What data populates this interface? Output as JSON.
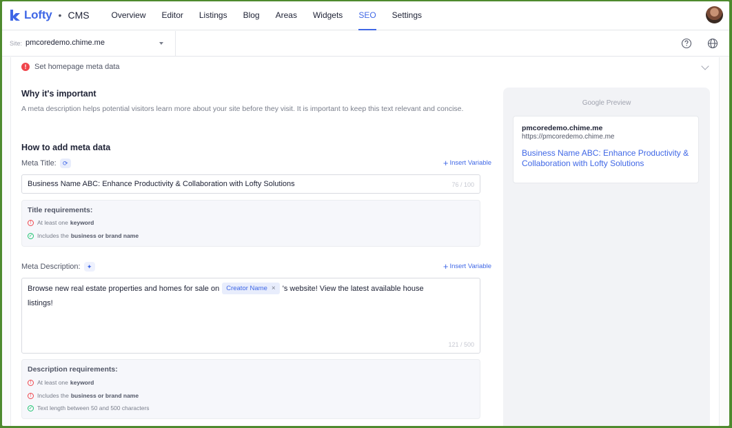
{
  "brand": {
    "name": "Lofty",
    "separator": "•",
    "product": "CMS",
    "accent": "#3f67e6"
  },
  "nav": {
    "items": [
      {
        "label": "Overview"
      },
      {
        "label": "Editor"
      },
      {
        "label": "Listings"
      },
      {
        "label": "Blog"
      },
      {
        "label": "Areas"
      },
      {
        "label": "Widgets"
      },
      {
        "label": "SEO",
        "active": true
      },
      {
        "label": "Settings"
      }
    ]
  },
  "site": {
    "label": "Site:",
    "value": "pmcoredemo.chime.me"
  },
  "icons": {
    "help": "help-circle-icon",
    "language": "globe-icon",
    "alert": "alert-icon"
  },
  "accordion": {
    "title": "Set homepage meta data"
  },
  "why": {
    "heading": "Why it's important",
    "text": "A meta description helps potential visitors learn more about your site before they visit. It is important to keep this text relevant and concise."
  },
  "how": {
    "heading": "How to add meta data"
  },
  "meta_title": {
    "label": "Meta Title:",
    "insert_variable": "Insert Variable",
    "value": "Business Name ABC: Enhance Productivity & Collaboration with Lofty Solutions",
    "counter": "76 / 100",
    "requirements": {
      "title": "Title requirements:",
      "items": [
        {
          "prefix": "At least one",
          "bold": "keyword",
          "status": "fail"
        },
        {
          "prefix": "Includes the",
          "bold": "business or brand name",
          "status": "pass"
        }
      ]
    }
  },
  "meta_description": {
    "label": "Meta Description:",
    "insert_variable": "Insert Variable",
    "text_before": "Browse new real estate properties and homes for sale on",
    "tag": "Creator Name",
    "text_after": "'s website! View the latest available house",
    "text_line2": "listings!",
    "counter": "121 / 500",
    "requirements": {
      "title": "Description requirements:",
      "items": [
        {
          "prefix": "At least one",
          "bold": "keyword",
          "status": "fail"
        },
        {
          "prefix": "Includes the",
          "bold": "business or brand name",
          "status": "fail"
        },
        {
          "prefix": "Text length between 50 and 500 characters",
          "bold": "",
          "status": "pass"
        }
      ]
    }
  },
  "preview": {
    "title": "Google Preview",
    "site_name": "pmcoredemo.chime.me",
    "url": "https://pmcoredemo.chime.me",
    "headline": "Business Name ABC: Enhance Productivity & Collaboration with Lofty Solutions"
  }
}
